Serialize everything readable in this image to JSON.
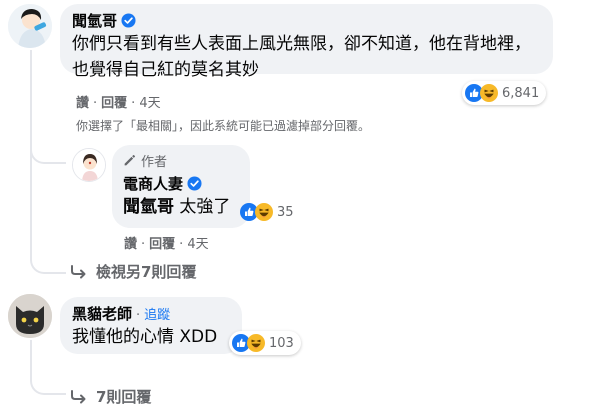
{
  "colors": {
    "bubble_bg": "#f0f2f5",
    "secondary_text": "#65676b",
    "link_blue": "#1877f2",
    "like_blue": "#1877f2",
    "haha_yellow": "#f7b928",
    "thread_line": "#e4e6eb"
  },
  "comment1": {
    "author": "聞氫哥",
    "verified_icon": "verified-badge-icon",
    "text": "你們只看到有些人表面上風光無限，卻不知道，他在背地裡，也覺得自己紅的莫名其妙",
    "reactions": {
      "icons": [
        "like-icon",
        "haha-icon"
      ],
      "count": "6,841"
    },
    "actions": {
      "like": "讚",
      "reply": "回覆",
      "time": "4天"
    },
    "filter_note": "你選擇了「最相關」，因此系統可能已過濾掉部分回覆。"
  },
  "reply1": {
    "author_tag": "作者",
    "author": "電商人妻",
    "mention": "聞氫哥",
    "text": "太強了",
    "reactions": {
      "icons": [
        "like-icon",
        "haha-icon"
      ],
      "count": "35"
    },
    "actions": {
      "like": "讚",
      "reply": "回覆",
      "time": "4天"
    }
  },
  "view_more_replies": "檢視另7則回覆",
  "comment2": {
    "author": "黑貓老師",
    "follow": "追蹤",
    "text": "我懂他的心情 XDD",
    "reactions": {
      "icons": [
        "like-icon",
        "haha-icon"
      ],
      "count": "103"
    },
    "actions": {
      "like": "讚",
      "reply": "回覆",
      "time": "4天"
    }
  },
  "replies_count_link": "7則回覆"
}
